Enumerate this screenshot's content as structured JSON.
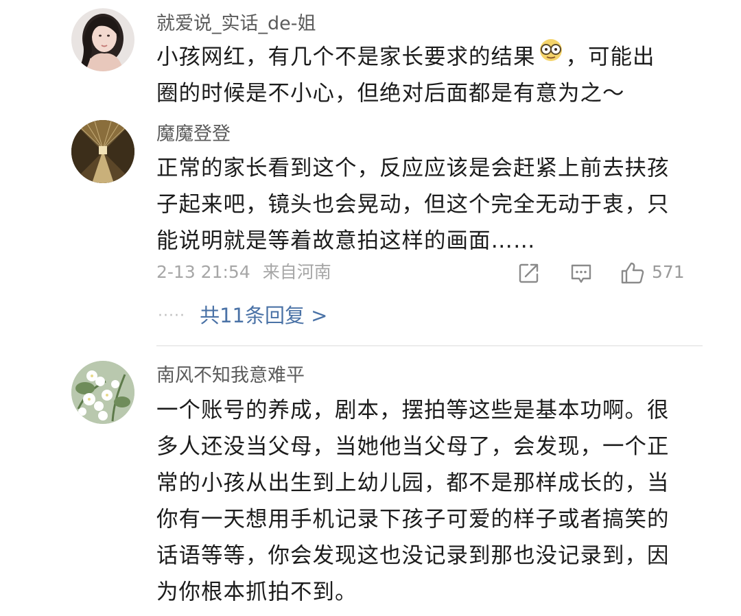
{
  "comments": [
    {
      "username": "就爱说_实话_de-姐",
      "lines": [
        "小孩网红，有几个不是家长要求的结果",
        "，可能出",
        "圈的时候是不小心，但绝对后面都是有意为之～"
      ],
      "emoji": "nerd-face-emoji"
    },
    {
      "username": "魔魔登登",
      "lines": [
        "正常的家长看到这个，反应应该是会赶紧上前去扶孩",
        "子起来吧，镜头也会晃动，但这个完全无动于衷，只",
        "能说明就是等着故意拍这样的画面……"
      ],
      "timestamp": "2-13 21:54",
      "location": "来自河南",
      "likes": "571",
      "replies_dots": "·····",
      "replies_label": "共11条回复 >"
    },
    {
      "username": "南风不知我意难平",
      "lines": [
        "一个账号的养成，剧本，摆拍等这些是基本功啊。很",
        "多人还没当父母，当她他当父母了，会发现，一个正",
        "常的小孩从出生到上幼儿园，都不是那样成长的，当",
        "你有一天想用手机记录下孩子可爱的样子或者搞笑的",
        "话语等等，你会发现这也没记录到那也没记录到，因",
        "为你根本抓拍不到。"
      ]
    }
  ],
  "icons": {
    "share": "share-icon",
    "comment": "comment-icon",
    "like": "thumbs-up-icon"
  },
  "colors": {
    "username": "#5b5b5b",
    "meta": "#a6a6a6",
    "link": "#4a72a6",
    "text": "#1c1c1c"
  }
}
